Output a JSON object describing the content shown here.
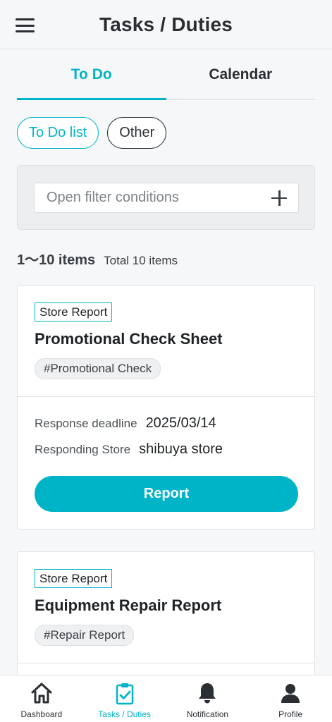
{
  "header": {
    "title": "Tasks / Duties"
  },
  "tabs": [
    {
      "label": "To Do",
      "active": true
    },
    {
      "label": "Calendar",
      "active": false
    }
  ],
  "chips": [
    {
      "label": "To Do list",
      "active": true
    },
    {
      "label": "Other",
      "active": false
    }
  ],
  "filter": {
    "placeholder": "Open filter conditions"
  },
  "count": {
    "range": "1〜10 items",
    "total": "Total 10 items"
  },
  "cards": [
    {
      "badge": "Store Report",
      "title": "Promotional Check Sheet",
      "tag": "#Promotional Check",
      "deadline_label": "Response deadline",
      "deadline_value": "2025/03/14",
      "store_label": "Responding Store",
      "store_value": "shibuya store",
      "button_label": "Report"
    },
    {
      "badge": "Store Report",
      "title": "Equipment Repair Report",
      "tag": "#Repair Report"
    }
  ],
  "bottom_nav": [
    {
      "label": "Dashboard",
      "icon": "home-icon"
    },
    {
      "label": "Tasks / Duties",
      "icon": "clipboard-check-icon",
      "active": true
    },
    {
      "label": "Notification",
      "icon": "bell-icon"
    },
    {
      "label": "Profile",
      "icon": "person-icon"
    }
  ],
  "colors": {
    "accent": "#00b4c8",
    "text": "#2b2f33",
    "background": "#f6f7f8"
  }
}
